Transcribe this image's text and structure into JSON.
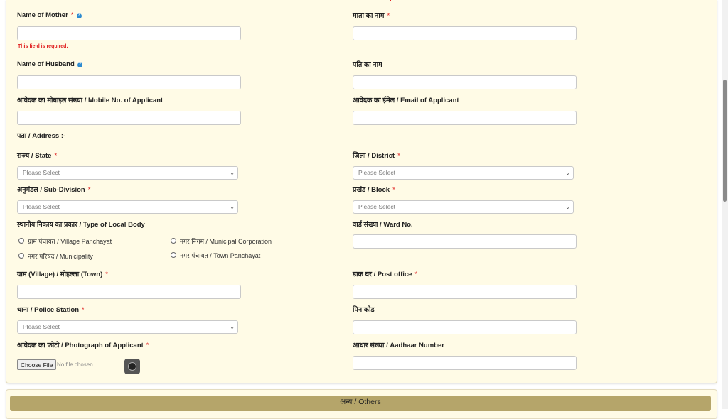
{
  "form": {
    "mother_en": "Name of Mother",
    "mother_hi": "माता का नाम",
    "required_error": "This field is required.",
    "husband_en": "Name of Husband",
    "husband_hi": "पति का नाम",
    "mobile": "आवेदक का मोबाइल संख्या / Mobile No. of Applicant",
    "email": "आवेदक का ईमेल / Email of Applicant",
    "address": "पता / Address :-",
    "state": "राज्य / State",
    "district": "जिला / District",
    "subdivision": "अनुमंडल / Sub-Division",
    "block": "प्रखंड / Block",
    "local_body": "स्थानीय निकाय का प्रकार / Type of Local Body",
    "ward": "वार्ड संख्या / Ward No.",
    "village": "ग्राम (Village) / मोहल्ला (Town)",
    "post_office": "डाक घर / Post office",
    "police_station": "थाना / Police Station",
    "pin": "पिन कोड",
    "photo": "आवेदक का फोटो / Photograph of Applicant",
    "aadhaar": "आधार संख्या / Aadhaar Number",
    "required_mark": "*",
    "info_mark": "?",
    "select_placeholder": "Please Select",
    "radio_options": [
      "ग्राम पंचायत / Village Panchayat",
      "नगर निगम / Municipal Corporation",
      "नगर परिषद / Municipality",
      "नगर पंचायत / Town Panchayat"
    ],
    "choose_file": "Choose File",
    "no_file": "No file chosen",
    "chevron": "⌄"
  },
  "sections": {
    "others": "अन्य / Others"
  }
}
